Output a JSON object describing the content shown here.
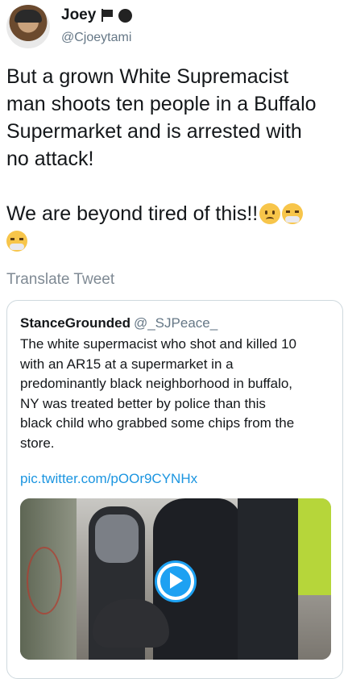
{
  "author": {
    "display_name": "Joey",
    "handle": "@Cjoeytami",
    "name_icons": [
      "flag-icon",
      "black-circle-icon"
    ]
  },
  "tweet": {
    "lines": [
      "But a grown White Supremacist",
      "man shoots ten people in a Buffalo",
      "Supermarket and is arrested with",
      "no attack!",
      "",
      "We are beyond tired of this!!"
    ],
    "emojis": [
      "confused-face-emoji",
      "face-with-steam-emoji",
      "face-with-steam-emoji"
    ],
    "translate_label": "Translate Tweet"
  },
  "quoted": {
    "display_name": "StanceGrounded",
    "handle": "@_SJPeace_",
    "lines": [
      "The white supermacist who shot and killed 10",
      "with an AR15 at a supermarket in a",
      "predominantly black neighborhood in buffalo,",
      "NY was treated better by police than this",
      "black child who grabbed some chips from the",
      "store."
    ],
    "link": "pic.twitter.com/pOOr9CYNHx",
    "media": {
      "type": "video",
      "play_icon": "play-icon"
    }
  },
  "colors": {
    "link": "#1b95e0",
    "secondary_text": "#657786",
    "border": "#cfd9de",
    "play": "#1da1f2"
  }
}
